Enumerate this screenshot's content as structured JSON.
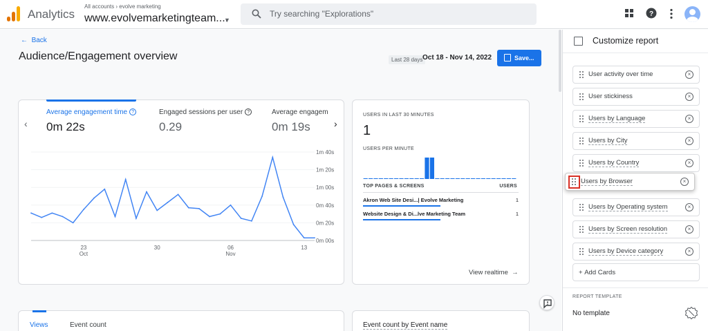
{
  "header": {
    "app_name": "Analytics",
    "breadcrumb_root": "All accounts",
    "breadcrumb_sep": "›",
    "breadcrumb_account": "evolve marketing",
    "property": "www.evolvemarketingteam....",
    "search_placeholder": "Try searching \"Explorations\"",
    "logo_colors": [
      "#f9ab00",
      "#e37400",
      "#e37400"
    ]
  },
  "page": {
    "back_label": "Back",
    "title": "Audience/Engagement overview",
    "date_label": "Last 28 days",
    "date_range": "Oct 18 - Nov 14, 2022",
    "save_label": "Save..."
  },
  "engagement_card": {
    "metrics": [
      {
        "label": "Average engagement time",
        "value": "0m 22s"
      },
      {
        "label": "Engaged sessions per user",
        "value": "0.29"
      },
      {
        "label": "Average engageme",
        "value": "0m 19s"
      }
    ]
  },
  "chart_data": {
    "type": "line",
    "x_tick_labels": [
      {
        "day": "23",
        "month": "Oct"
      },
      {
        "day": "30",
        "month": ""
      },
      {
        "day": "06",
        "month": "Nov"
      },
      {
        "day": "13",
        "month": ""
      }
    ],
    "y_tick_labels": [
      "1m 40s",
      "1m 20s",
      "1m 00s",
      "0m 40s",
      "0m 20s",
      "0m 00s"
    ],
    "ylim": [
      0,
      100
    ],
    "x": [
      18,
      19,
      20,
      21,
      22,
      23,
      24,
      25,
      26,
      27,
      28,
      29,
      30,
      31,
      1,
      2,
      3,
      4,
      5,
      6,
      7,
      8,
      9,
      10,
      11,
      12,
      13,
      14
    ],
    "values": [
      31,
      26,
      31,
      27,
      20,
      35,
      48,
      58,
      27,
      69,
      25,
      55,
      34,
      43,
      52,
      37,
      36,
      27,
      30,
      40,
      25,
      22,
      50,
      94,
      49,
      18,
      3,
      3
    ],
    "series_color": "#4285f4",
    "grid": true
  },
  "realtime_card": {
    "title": "USERS IN LAST 30 MINUTES",
    "count": "1",
    "per_minute_label": "USERS PER MINUTE",
    "per_minute_values": [
      0,
      0,
      0,
      0,
      0,
      0,
      0,
      0,
      0,
      0,
      0,
      0,
      1,
      1,
      0,
      0,
      0,
      0,
      0,
      0,
      0,
      0,
      0,
      0,
      0,
      0,
      0,
      0,
      0,
      0
    ],
    "table_header_left": "TOP PAGES & SCREENS",
    "table_header_right": "USERS",
    "rows": [
      {
        "page": "Akron Web Site Desi...| Evolve Marketing",
        "users": "1"
      },
      {
        "page": "Website Design & Di...lve Marketing Team",
        "users": "1"
      }
    ],
    "view_realtime": "View realtime",
    "bar_color": "#1a73e8"
  },
  "bottom_cards": {
    "tabs": [
      "Views",
      "Event count"
    ],
    "event_title": "Event count by Event name"
  },
  "side_panel": {
    "title": "Customize report",
    "cards": [
      "User activity over time",
      "User stickiness",
      "Users by Language",
      "Users by City",
      "Users by Country",
      "Users by Browser",
      "Users by Operating system",
      "Users by Screen resolution",
      "Users by Device category"
    ],
    "add_cards": "Add Cards",
    "template_label": "REPORT TEMPLATE",
    "template_value": "No template"
  }
}
